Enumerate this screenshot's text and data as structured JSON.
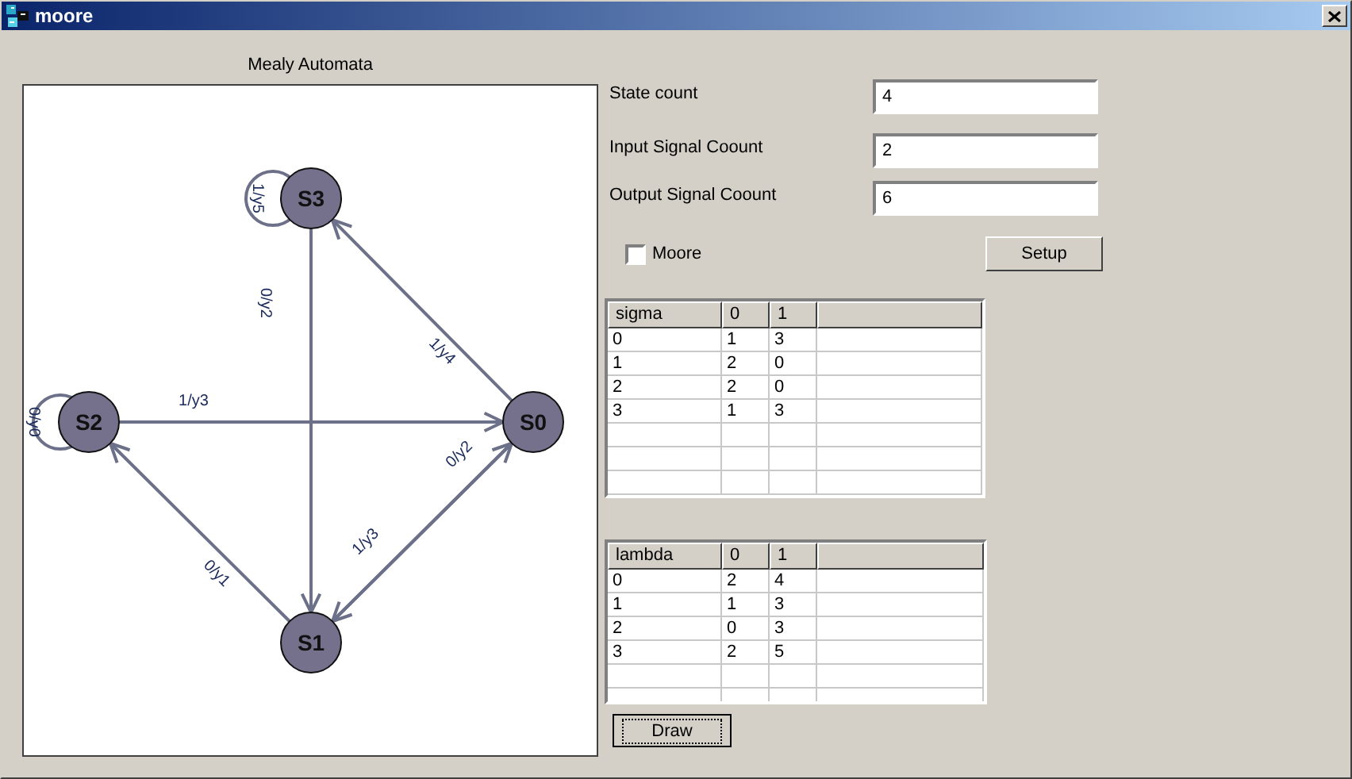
{
  "window": {
    "title": "moore"
  },
  "diagram": {
    "title": "Mealy Automata",
    "states": [
      {
        "name": "S0"
      },
      {
        "name": "S1"
      },
      {
        "name": "S2"
      },
      {
        "name": "S3"
      }
    ],
    "transitions": [
      {
        "label": "0/y2"
      },
      {
        "label": "1/y4"
      },
      {
        "label": "0/y1"
      },
      {
        "label": "1/y3"
      },
      {
        "label": "0/y0"
      },
      {
        "label": "1/y3"
      },
      {
        "label": "0/y2"
      },
      {
        "label": "1/y5"
      }
    ]
  },
  "fields": [
    {
      "label": "State count",
      "value": "4"
    },
    {
      "label": "Input Signal Coount",
      "value": "2"
    },
    {
      "label": "Output Signal Coount",
      "value": "6"
    }
  ],
  "moore": {
    "label": "Moore",
    "checked": false
  },
  "setup_button": "Setup",
  "tables": [
    {
      "columns": [
        "sigma",
        "0",
        "1"
      ],
      "rows": [
        [
          "0",
          "1",
          "3"
        ],
        [
          "1",
          "2",
          "0"
        ],
        [
          "2",
          "2",
          "0"
        ],
        [
          "3",
          "1",
          "3"
        ]
      ]
    },
    {
      "columns": [
        "lambda",
        "0",
        "1"
      ],
      "rows": [
        [
          "0",
          "2",
          "4"
        ],
        [
          "1",
          "1",
          "3"
        ],
        [
          "2",
          "0",
          "3"
        ],
        [
          "3",
          "2",
          "5"
        ]
      ]
    }
  ],
  "draw_button": "Draw"
}
